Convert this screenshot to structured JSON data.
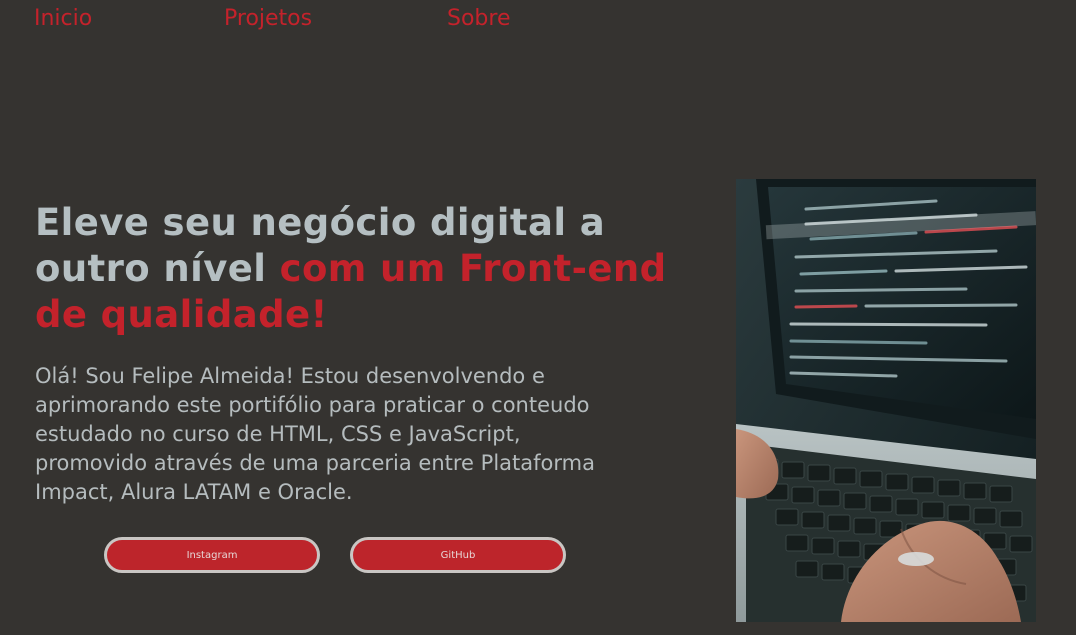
{
  "nav": {
    "items": [
      {
        "label": "Inicio"
      },
      {
        "label": "Projetos"
      },
      {
        "label": "Sobre"
      }
    ]
  },
  "hero": {
    "headline_part1": "Eleve seu negócio digital a outro nível ",
    "headline_accent": "com um Front-end de qualidade!",
    "intro": "Olá! Sou Felipe Almeida! Estou desenvolvendo e aprimorando este portifólio para praticar o conteudo estudado no curso de HTML, CSS e JavaScript, promovido através de uma parceria entre Plataforma Impact, Alura LATAM e Oracle.",
    "buttons": [
      {
        "label": "Instagram"
      },
      {
        "label": "GitHub"
      }
    ]
  },
  "colors": {
    "background": "#353330",
    "accent": "#c4222b",
    "text": "#b5bfc2"
  }
}
